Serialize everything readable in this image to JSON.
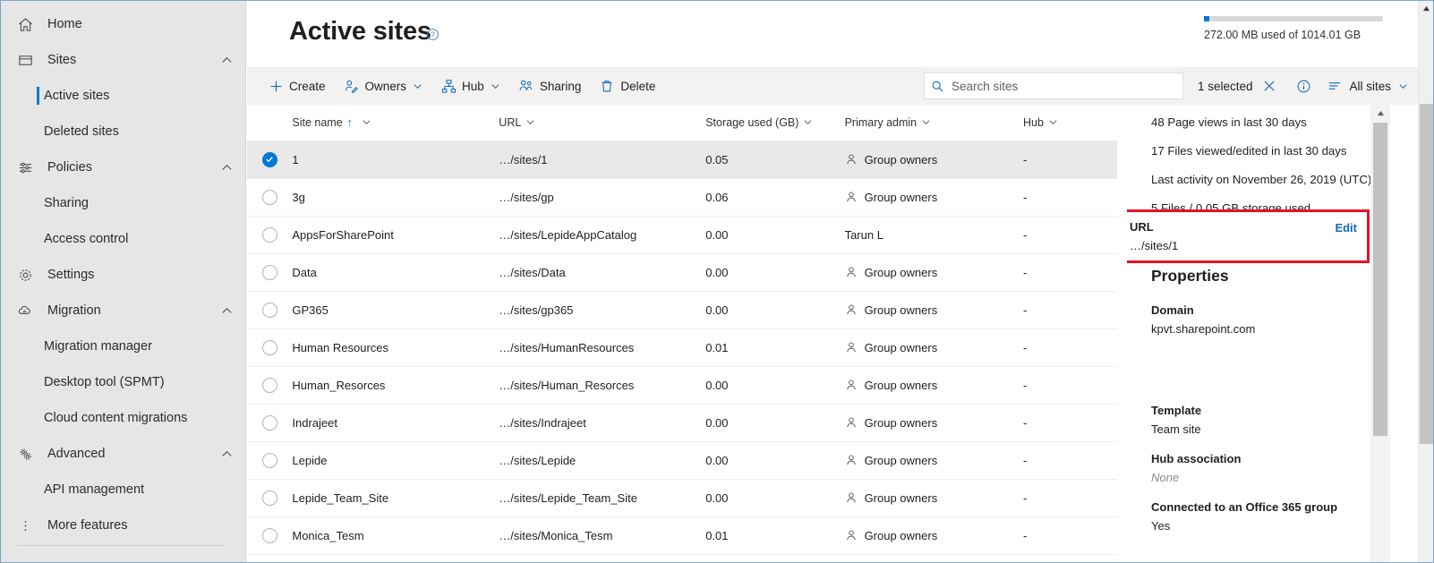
{
  "sidebar": {
    "items": [
      {
        "label": "Home",
        "icon": "home-icon",
        "type": "top",
        "expandable": false
      },
      {
        "label": "Sites",
        "icon": "sites-icon",
        "type": "top",
        "expandable": true,
        "expanded": true
      },
      {
        "label": "Active sites",
        "type": "sub",
        "selected": true
      },
      {
        "label": "Deleted sites",
        "type": "sub",
        "selected": false
      },
      {
        "label": "Policies",
        "icon": "policies-icon",
        "type": "top",
        "expandable": true,
        "expanded": true
      },
      {
        "label": "Sharing",
        "type": "sub",
        "selected": false
      },
      {
        "label": "Access control",
        "type": "sub",
        "selected": false
      },
      {
        "label": "Settings",
        "icon": "gear-icon",
        "type": "top",
        "expandable": false
      },
      {
        "label": "Migration",
        "icon": "cloud-upload-icon",
        "type": "top",
        "expandable": true,
        "expanded": true
      },
      {
        "label": "Migration manager",
        "type": "sub",
        "selected": false
      },
      {
        "label": "Desktop tool (SPMT)",
        "type": "sub",
        "selected": false
      },
      {
        "label": "Cloud content migrations",
        "type": "sub",
        "selected": false
      },
      {
        "label": "Advanced",
        "icon": "advanced-gears-icon",
        "type": "top",
        "expandable": true,
        "expanded": true
      },
      {
        "label": "API management",
        "type": "sub",
        "selected": false
      },
      {
        "label": "More features",
        "icon": "more-vertical-icon",
        "type": "top",
        "expandable": false
      }
    ]
  },
  "header": {
    "title": "Active sites",
    "help_icon": "help-circle-icon",
    "storage": {
      "text": "272.00 MB used of 1014.01 GB",
      "percent": 3,
      "fill_color": "#0078d4",
      "track_color": "#d8d8d8"
    }
  },
  "commandbar": {
    "buttons": [
      {
        "label": "Create",
        "icon": "plus-icon",
        "has_chevron": false
      },
      {
        "label": "Owners",
        "icon": "owners-person-edit-icon",
        "has_chevron": true
      },
      {
        "label": "Hub",
        "icon": "hub-hierarchy-icon",
        "has_chevron": true
      },
      {
        "label": "Sharing",
        "icon": "sharing-people-icon",
        "has_chevron": false
      },
      {
        "label": "Delete",
        "icon": "trash-icon",
        "has_chevron": false
      }
    ],
    "search": {
      "placeholder": "Search sites",
      "value": "",
      "icon": "search-icon"
    },
    "selection_count": "1 selected",
    "clear_selection_icon": "close-x-icon",
    "info_icon": "info-circle-icon",
    "filter": {
      "label": "All sites",
      "icon": "list-lines-icon",
      "has_chevron": true
    }
  },
  "table": {
    "columns": [
      {
        "label": "Site name",
        "sorted": "asc",
        "sort_glyph": "↑",
        "has_chevron": true
      },
      {
        "label": "URL",
        "has_chevron": true
      },
      {
        "label": "Storage used (GB)",
        "has_chevron": true
      },
      {
        "label": "Primary admin",
        "has_chevron": true
      },
      {
        "label": "Hub",
        "has_chevron": true
      }
    ],
    "rows": [
      {
        "selected": true,
        "name": "1",
        "url": "…/sites/1",
        "storage": "0.05",
        "admin": "Group owners",
        "admin_icon": true,
        "hub": "-"
      },
      {
        "selected": false,
        "name": "3g",
        "url": "…/sites/gp",
        "storage": "0.06",
        "admin": "Group owners",
        "admin_icon": true,
        "hub": "-"
      },
      {
        "selected": false,
        "name": "AppsForSharePoint",
        "url": "…/sites/LepideAppCatalog",
        "storage": "0.00",
        "admin": "Tarun L",
        "admin_icon": false,
        "hub": "-"
      },
      {
        "selected": false,
        "name": "Data",
        "url": "…/sites/Data",
        "storage": "0.00",
        "admin": "Group owners",
        "admin_icon": true,
        "hub": "-"
      },
      {
        "selected": false,
        "name": "GP365",
        "url": "…/sites/gp365",
        "storage": "0.00",
        "admin": "Group owners",
        "admin_icon": true,
        "hub": "-"
      },
      {
        "selected": false,
        "name": "Human Resources",
        "url": "…/sites/HumanResources",
        "storage": "0.01",
        "admin": "Group owners",
        "admin_icon": true,
        "hub": "-"
      },
      {
        "selected": false,
        "name": "Human_Resorces",
        "url": "…/sites/Human_Resorces",
        "storage": "0.00",
        "admin": "Group owners",
        "admin_icon": true,
        "hub": "-"
      },
      {
        "selected": false,
        "name": "Indrajeet",
        "url": "…/sites/Indrajeet",
        "storage": "0.00",
        "admin": "Group owners",
        "admin_icon": true,
        "hub": "-"
      },
      {
        "selected": false,
        "name": "Lepide",
        "url": "…/sites/Lepide",
        "storage": "0.00",
        "admin": "Group owners",
        "admin_icon": true,
        "hub": "-"
      },
      {
        "selected": false,
        "name": "Lepide_Team_Site",
        "url": "…/sites/Lepide_Team_Site",
        "storage": "0.00",
        "admin": "Group owners",
        "admin_icon": true,
        "hub": "-"
      },
      {
        "selected": false,
        "name": "Monica_Tesm",
        "url": "…/sites/Monica_Tesm",
        "storage": "0.01",
        "admin": "Group owners",
        "admin_icon": true,
        "hub": "-"
      }
    ]
  },
  "details": {
    "stats": [
      "48 Page views in last 30 days",
      "17 Files viewed/edited in last 30 days",
      "Last activity on November 26, 2019 (UTC)",
      "5 Files / 0.05 GB storage used"
    ],
    "properties_heading": "Properties",
    "properties": [
      {
        "label": "Domain",
        "value": "kpvt.sharepoint.com",
        "muted": false
      },
      {
        "label": "Template",
        "value": "Team site",
        "muted": false
      },
      {
        "label": "Hub association",
        "value": "None",
        "muted": true
      },
      {
        "label": "Connected to an Office 365 group",
        "value": "Yes",
        "muted": false
      }
    ],
    "url_property": {
      "label": "URL",
      "value": "…/sites/1",
      "edit_label": "Edit",
      "highlight_color": "#e81123"
    }
  }
}
